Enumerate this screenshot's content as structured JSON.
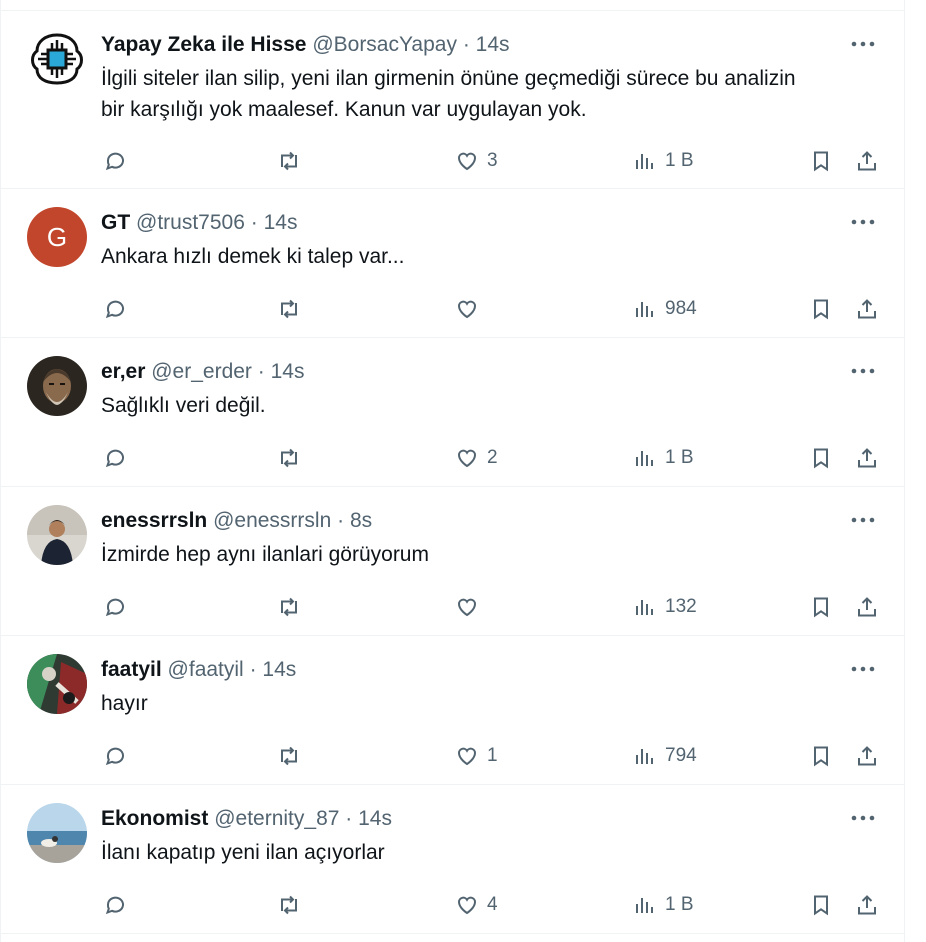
{
  "tweets": [
    {
      "name": "Yapay Zeka ile Hisse",
      "handle": "@BorsacYapay",
      "sep": "·",
      "time": "14s",
      "text_lines": [
        "İlgili siteler ilan silip, yeni ilan girmenin önüne geçmediği sürece bu analizin",
        "bir karşılığı yok maalesef. Kanun var uygulayan yok."
      ],
      "likes": "3",
      "views": "1 B",
      "avatar": "chip-logo"
    },
    {
      "name": "GT",
      "handle": "@trust7506",
      "sep": "·",
      "time": "14s",
      "text_lines": [
        "Ankara hızlı demek ki talep var..."
      ],
      "likes": "",
      "views": "984",
      "avatar": "initial",
      "avatar_letter": "G",
      "avatar_color": "#c1462b"
    },
    {
      "name": "er,er",
      "handle": "@er_erder",
      "sep": "·",
      "time": "14s",
      "text_lines": [
        "Sağlıklı veri değil."
      ],
      "likes": "2",
      "views": "1 B",
      "avatar": "portrait-dark"
    },
    {
      "name": "enessrrsln",
      "handle": "@enessrrsln",
      "sep": "·",
      "time": "8s",
      "text_lines": [
        "İzmirde hep aynı ilanlari görüyorum"
      ],
      "likes": "",
      "views": "132",
      "avatar": "person-photo"
    },
    {
      "name": "faatyil",
      "handle": "@faatyil",
      "sep": "·",
      "time": "14s",
      "text_lines": [
        "hayır"
      ],
      "likes": "1",
      "views": "794",
      "avatar": "art-photo"
    },
    {
      "name": "Ekonomist",
      "handle": "@eternity_87",
      "sep": "·",
      "time": "14s",
      "text_lines": [
        "İlanı kapatıp yeni ilan açıyorlar"
      ],
      "likes": "4",
      "views": "1 B",
      "avatar": "sea-photo"
    }
  ],
  "colors": {
    "text": "#0f1419",
    "secondary": "#536471",
    "border": "#eff3f4"
  }
}
